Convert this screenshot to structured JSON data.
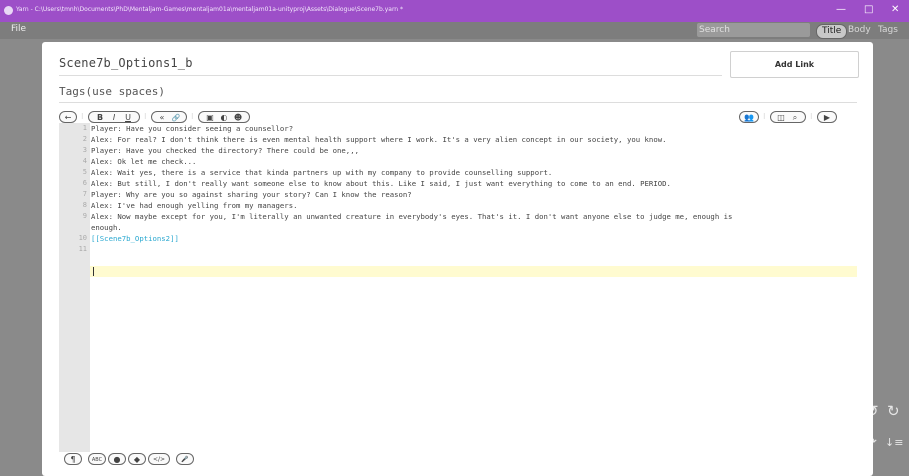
{
  "window": {
    "title": "Yarn - C:\\Users\\tmnh\\Documents\\PhD\\Mentaljam-Games\\mentaljam01a\\mentaljam01a-unityproj\\Assets\\Dialogue\\Scene7b.yarn *",
    "minimize": "—",
    "maximize": "□",
    "close": "✕"
  },
  "menu": {
    "file": "File"
  },
  "search": {
    "placeholder": "Search",
    "options": [
      "Title",
      "Body",
      "Tags"
    ],
    "active": "Title"
  },
  "editor": {
    "node_title": "Scene7b_Options1_b",
    "add_link": "Add Link",
    "tags_placeholder": "Tags(use spaces)",
    "lines": [
      "Player: Have you consider seeing a counsellor?",
      "Alex: For real? I don't think there is even mental health support where I work. It's a very alien concept in our society, you know.",
      "Player: Have you checked the directory? There could be one,,,",
      "Alex: Ok let me check...",
      "Alex: Wait yes, there is a service that kinda partners up with my company to provide counselling support.",
      "Alex: But still, I don't really want someone else to know about this. Like I said, I just want everything to come to an end. PERIOD.",
      "Player: Why are you so against sharing your story? Can I know the reason?",
      "Alex: I've had enough yelling from my managers.",
      "Alex: Now maybe except for you, I'm literally an unwanted creature in everybody's eyes. That's it. I don't want anyone else to judge me, enough is",
      "enough.",
      "[[Scene7b_Options2]]",
      ""
    ],
    "line_numbers": [
      "1",
      "2",
      "3",
      "4",
      "5",
      "6",
      "7",
      "8",
      "9",
      "",
      "10",
      "11"
    ]
  },
  "toolbar": {
    "undo": "←",
    "bold": "B",
    "italic": "I",
    "underline": "U",
    "quote": "«",
    "link": "🔗",
    "image": "▣",
    "color": "◐",
    "emoji": "☻",
    "users": "👥",
    "columns": "◫",
    "search": "⌕",
    "play": "▶"
  },
  "bottom_toolbar": [
    "¶",
    "ABC",
    "●",
    "◆",
    "</>",
    "🎤"
  ],
  "side_icons": {
    "undo": "↺",
    "redo": "↻",
    "refresh": "⟳",
    "sort": "↓≡"
  },
  "colors": {
    "titlebar": "#9d4fc8",
    "link": "#2aa8d0",
    "active_line": "#fffbd0"
  }
}
